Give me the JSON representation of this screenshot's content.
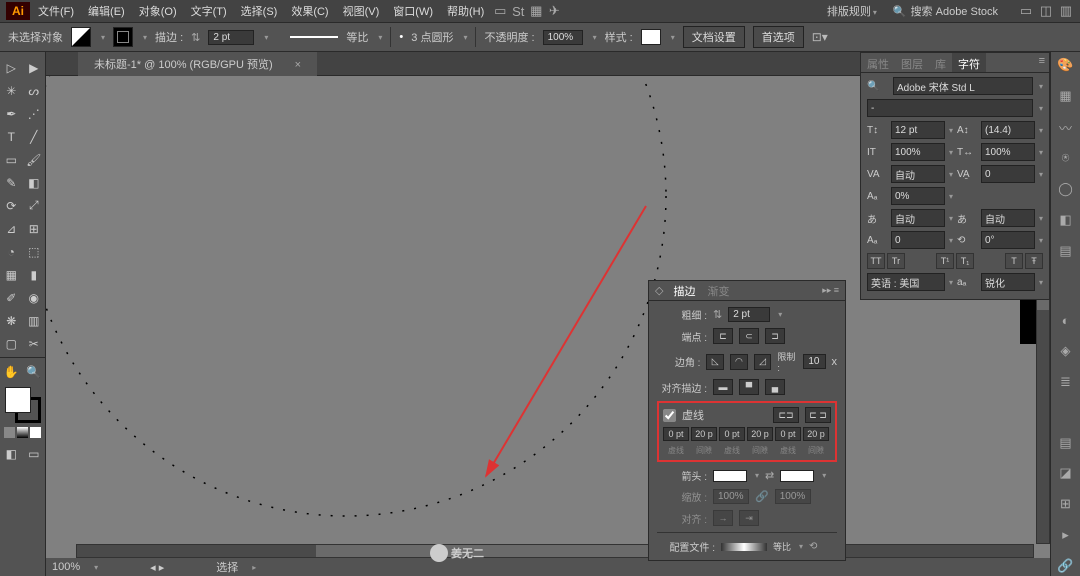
{
  "app": {
    "name": "Ai"
  },
  "menu": {
    "file": "文件(F)",
    "edit": "编辑(E)",
    "object": "对象(O)",
    "text": "文字(T)",
    "select": "选择(S)",
    "effect": "效果(C)",
    "view": "视图(V)",
    "window": "窗口(W)",
    "help": "帮助(H)"
  },
  "workspace": {
    "name": "排版规则"
  },
  "search": {
    "placeholder": "搜索 Adobe Stock"
  },
  "control": {
    "no_selection": "未选择对象",
    "stroke": "描边 :",
    "stroke_val": "2 pt",
    "uniform": "等比",
    "brush": "3 点圆形",
    "opacity": "不透明度 :",
    "opacity_val": "100%",
    "style": "样式 :",
    "doc_setup": "文档设置",
    "prefs": "首选项"
  },
  "doc": {
    "tab": "未标题-1* @ 100% (RGB/GPU 预览)"
  },
  "status": {
    "zoom": "100%",
    "selection": "选择"
  },
  "char": {
    "tab_props": "属性",
    "tab_layers": "图层",
    "tab_lib": "库",
    "tab_char": "字符",
    "font": "Adobe 宋体 Std L",
    "style": "-",
    "size": "12 pt",
    "leading": "(14.4)",
    "h": "100%",
    "v": "100%",
    "kerning": "自动",
    "tracking": "0",
    "baseline": "0%",
    "auto": "自动",
    "rotate": "0°",
    "tt": "TT",
    "tr": "Tr",
    "t1": "T¹",
    "t2": "T₁",
    "tcap": "T",
    "tstrike": "Ŧ",
    "lang": "英语 : 美国",
    "aa": "锐化",
    "aa_lbl": "aₐ"
  },
  "stroke": {
    "tab_stroke": "描边",
    "tab_grad": "渐变",
    "weight": "粗细 :",
    "weight_val": "2 pt",
    "cap": "端点 :",
    "corner": "边角 :",
    "limit": "限制 :",
    "limit_val": "10",
    "x": "x",
    "align": "对齐描边 :",
    "dashed": "虚线",
    "dash_vals": [
      "0 pt",
      "20 p",
      "0 pt",
      "20 p",
      "0 pt",
      "20 p"
    ],
    "dash_labels": [
      "虚线",
      "间隙",
      "虚线",
      "间隙",
      "虚线",
      "间隙"
    ],
    "arrow": "箭头 :",
    "scale": "缩放 :",
    "scale1": "100%",
    "scale2": "100%",
    "align2": "对齐 :",
    "profile": "配置文件 :",
    "profile_val": "等比"
  },
  "watermark": "姜无二"
}
